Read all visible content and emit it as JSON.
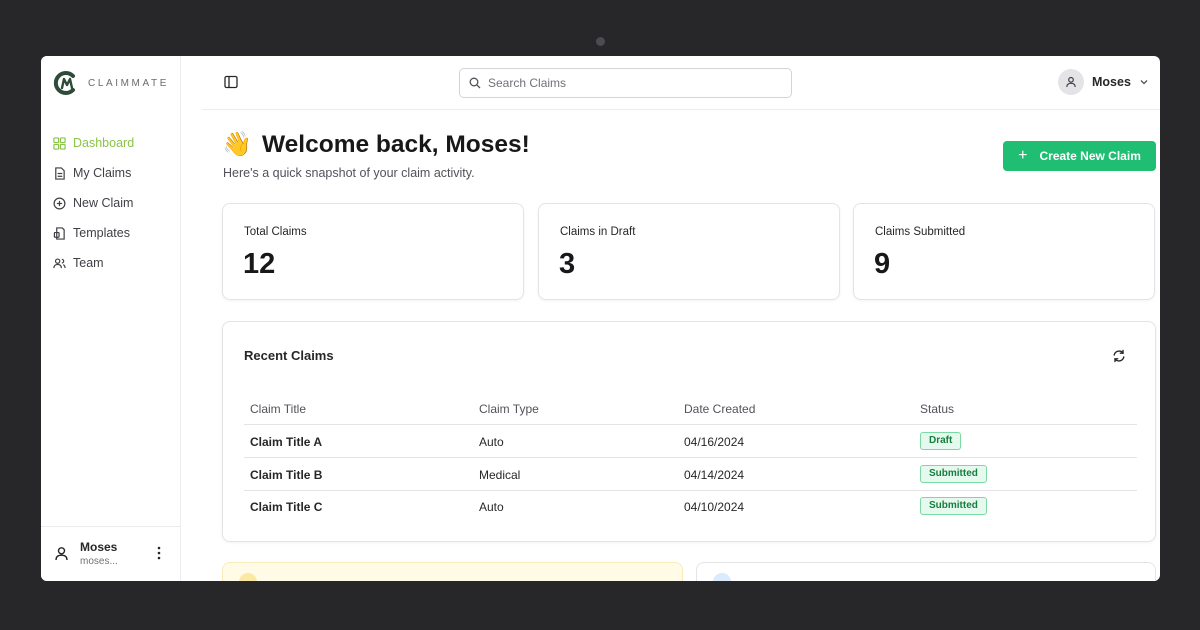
{
  "brand": {
    "name": "CLAIMMATE",
    "logo_icon": "claimmate-logo",
    "accent": "#8bc34a"
  },
  "sidebar": {
    "items": [
      {
        "label": "Dashboard",
        "icon": "grid-icon",
        "active": true
      },
      {
        "label": "My Claims",
        "icon": "document-icon",
        "active": false
      },
      {
        "label": "New Claim",
        "icon": "plus-circle-icon",
        "active": false
      },
      {
        "label": "Templates",
        "icon": "template-icon",
        "active": false
      },
      {
        "label": "Team",
        "icon": "users-icon",
        "active": false
      }
    ],
    "user": {
      "name": "Moses",
      "email": "moses..."
    }
  },
  "topbar": {
    "search_placeholder": "Search Claims",
    "user_name": "Moses"
  },
  "main": {
    "wave_emoji": "👋",
    "welcome": "Welcome back, Moses!",
    "subtitle": "Here's a quick snapshot of your claim activity.",
    "create_button": "Create New Claim",
    "primary_color": "#1fbe73",
    "stats": [
      {
        "label": "Total Claims",
        "value": "12"
      },
      {
        "label": "Claims in Draft",
        "value": "3"
      },
      {
        "label": "Claims Submitted",
        "value": "9"
      }
    ],
    "recent": {
      "title": "Recent Claims",
      "columns": [
        "Claim Title",
        "Claim Type",
        "Date Created",
        "Status"
      ],
      "rows": [
        {
          "title": "Claim Title A",
          "type": "Auto",
          "date": "04/16/2024",
          "status": "Draft"
        },
        {
          "title": "Claim Title B",
          "type": "Medical",
          "date": "04/14/2024",
          "status": "Submitted"
        },
        {
          "title": "Claim Title C",
          "type": "Auto",
          "date": "04/10/2024",
          "status": "Submitted"
        }
      ]
    }
  }
}
